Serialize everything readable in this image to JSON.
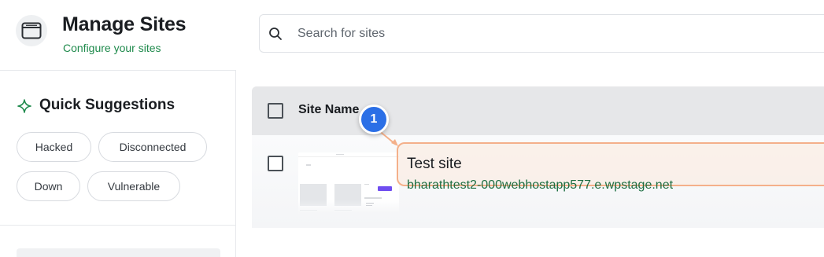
{
  "header": {
    "title": "Manage Sites",
    "subtitle": "Configure your sites",
    "icon": "browser-window-icon"
  },
  "search": {
    "placeholder": "Search for sites",
    "value": "",
    "icon": "search-icon"
  },
  "sidebar": {
    "quick_suggestions": {
      "title": "Quick Suggestions",
      "icon": "sparkle-icon",
      "chips": [
        "Hacked",
        "Disconnected",
        "Down",
        "Vulnerable"
      ]
    }
  },
  "table": {
    "columns": [
      "Site Name"
    ],
    "rows": [
      {
        "name": "Test site",
        "url": "bharathtest2-000webhostapp577.e.wpstage.net",
        "checked": false
      }
    ]
  },
  "annotation": {
    "step": "1"
  },
  "colors": {
    "accent_green": "#1f8a4c",
    "url_green": "#1d6e42",
    "highlight_border": "#f4b08a",
    "highlight_fill": "#fce9dd",
    "step_badge": "#2b6fe6",
    "table_header": "#e6e7e9"
  }
}
